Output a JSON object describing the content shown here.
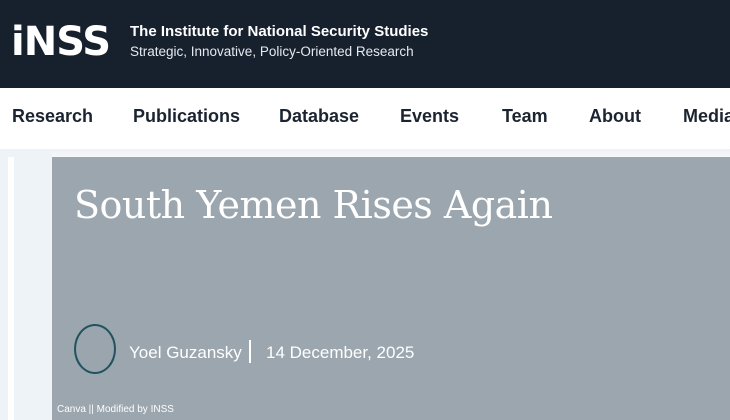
{
  "header": {
    "logo_mark": "iNSS",
    "org_name": "The Institute for National Security Studies",
    "tagline": "Strategic, Innovative, Policy-Oriented Research"
  },
  "nav": {
    "items": [
      {
        "label": "Research"
      },
      {
        "label": "Publications"
      },
      {
        "label": "Database"
      },
      {
        "label": "Events"
      },
      {
        "label": "Team"
      },
      {
        "label": "About"
      },
      {
        "label": "Media"
      }
    ]
  },
  "article": {
    "title": "South Yemen Rises Again",
    "author": "Yoel Guzansky",
    "date": "14 December, 2025",
    "image_credit": "Canva || Modified by INSS"
  },
  "colors": {
    "header_bg": "#17212e",
    "hero_bg": "#9ba6ae",
    "avatar_ring": "#22525f"
  }
}
